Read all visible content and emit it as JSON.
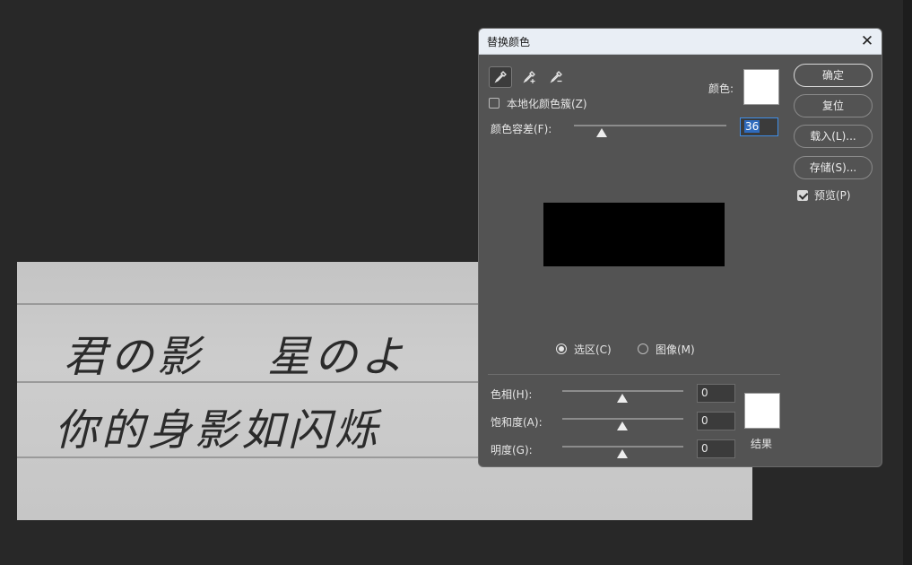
{
  "dialog": {
    "title": "替换颜色",
    "localized_clusters_label": "本地化颜色簇(Z)",
    "color_label": "颜色:",
    "fuzziness_label": "颜色容差(F):",
    "fuzziness_value": "36",
    "fuzziness_fraction": 0.18,
    "selection_radio": "选区(C)",
    "image_radio": "图像(M)",
    "hue_label": "色相(H):",
    "hue_value": "0",
    "saturation_label": "饱和度(A):",
    "saturation_value": "0",
    "lightness_label": "明度(G):",
    "lightness_value": "0",
    "result_label": "结果",
    "color_swatch": "#ffffff",
    "result_swatch": "#ffffff"
  },
  "buttons": {
    "ok": "确定",
    "reset": "复位",
    "load": "载入(L)...",
    "save": "存储(S)...",
    "preview": "预览(P)"
  },
  "tools": [
    "eyedropper-icon",
    "eyedropper-plus-icon",
    "eyedropper-minus-icon"
  ],
  "canvas": {
    "line1": "君の影　 星のよ",
    "line2": "你的身影如闪烁"
  }
}
